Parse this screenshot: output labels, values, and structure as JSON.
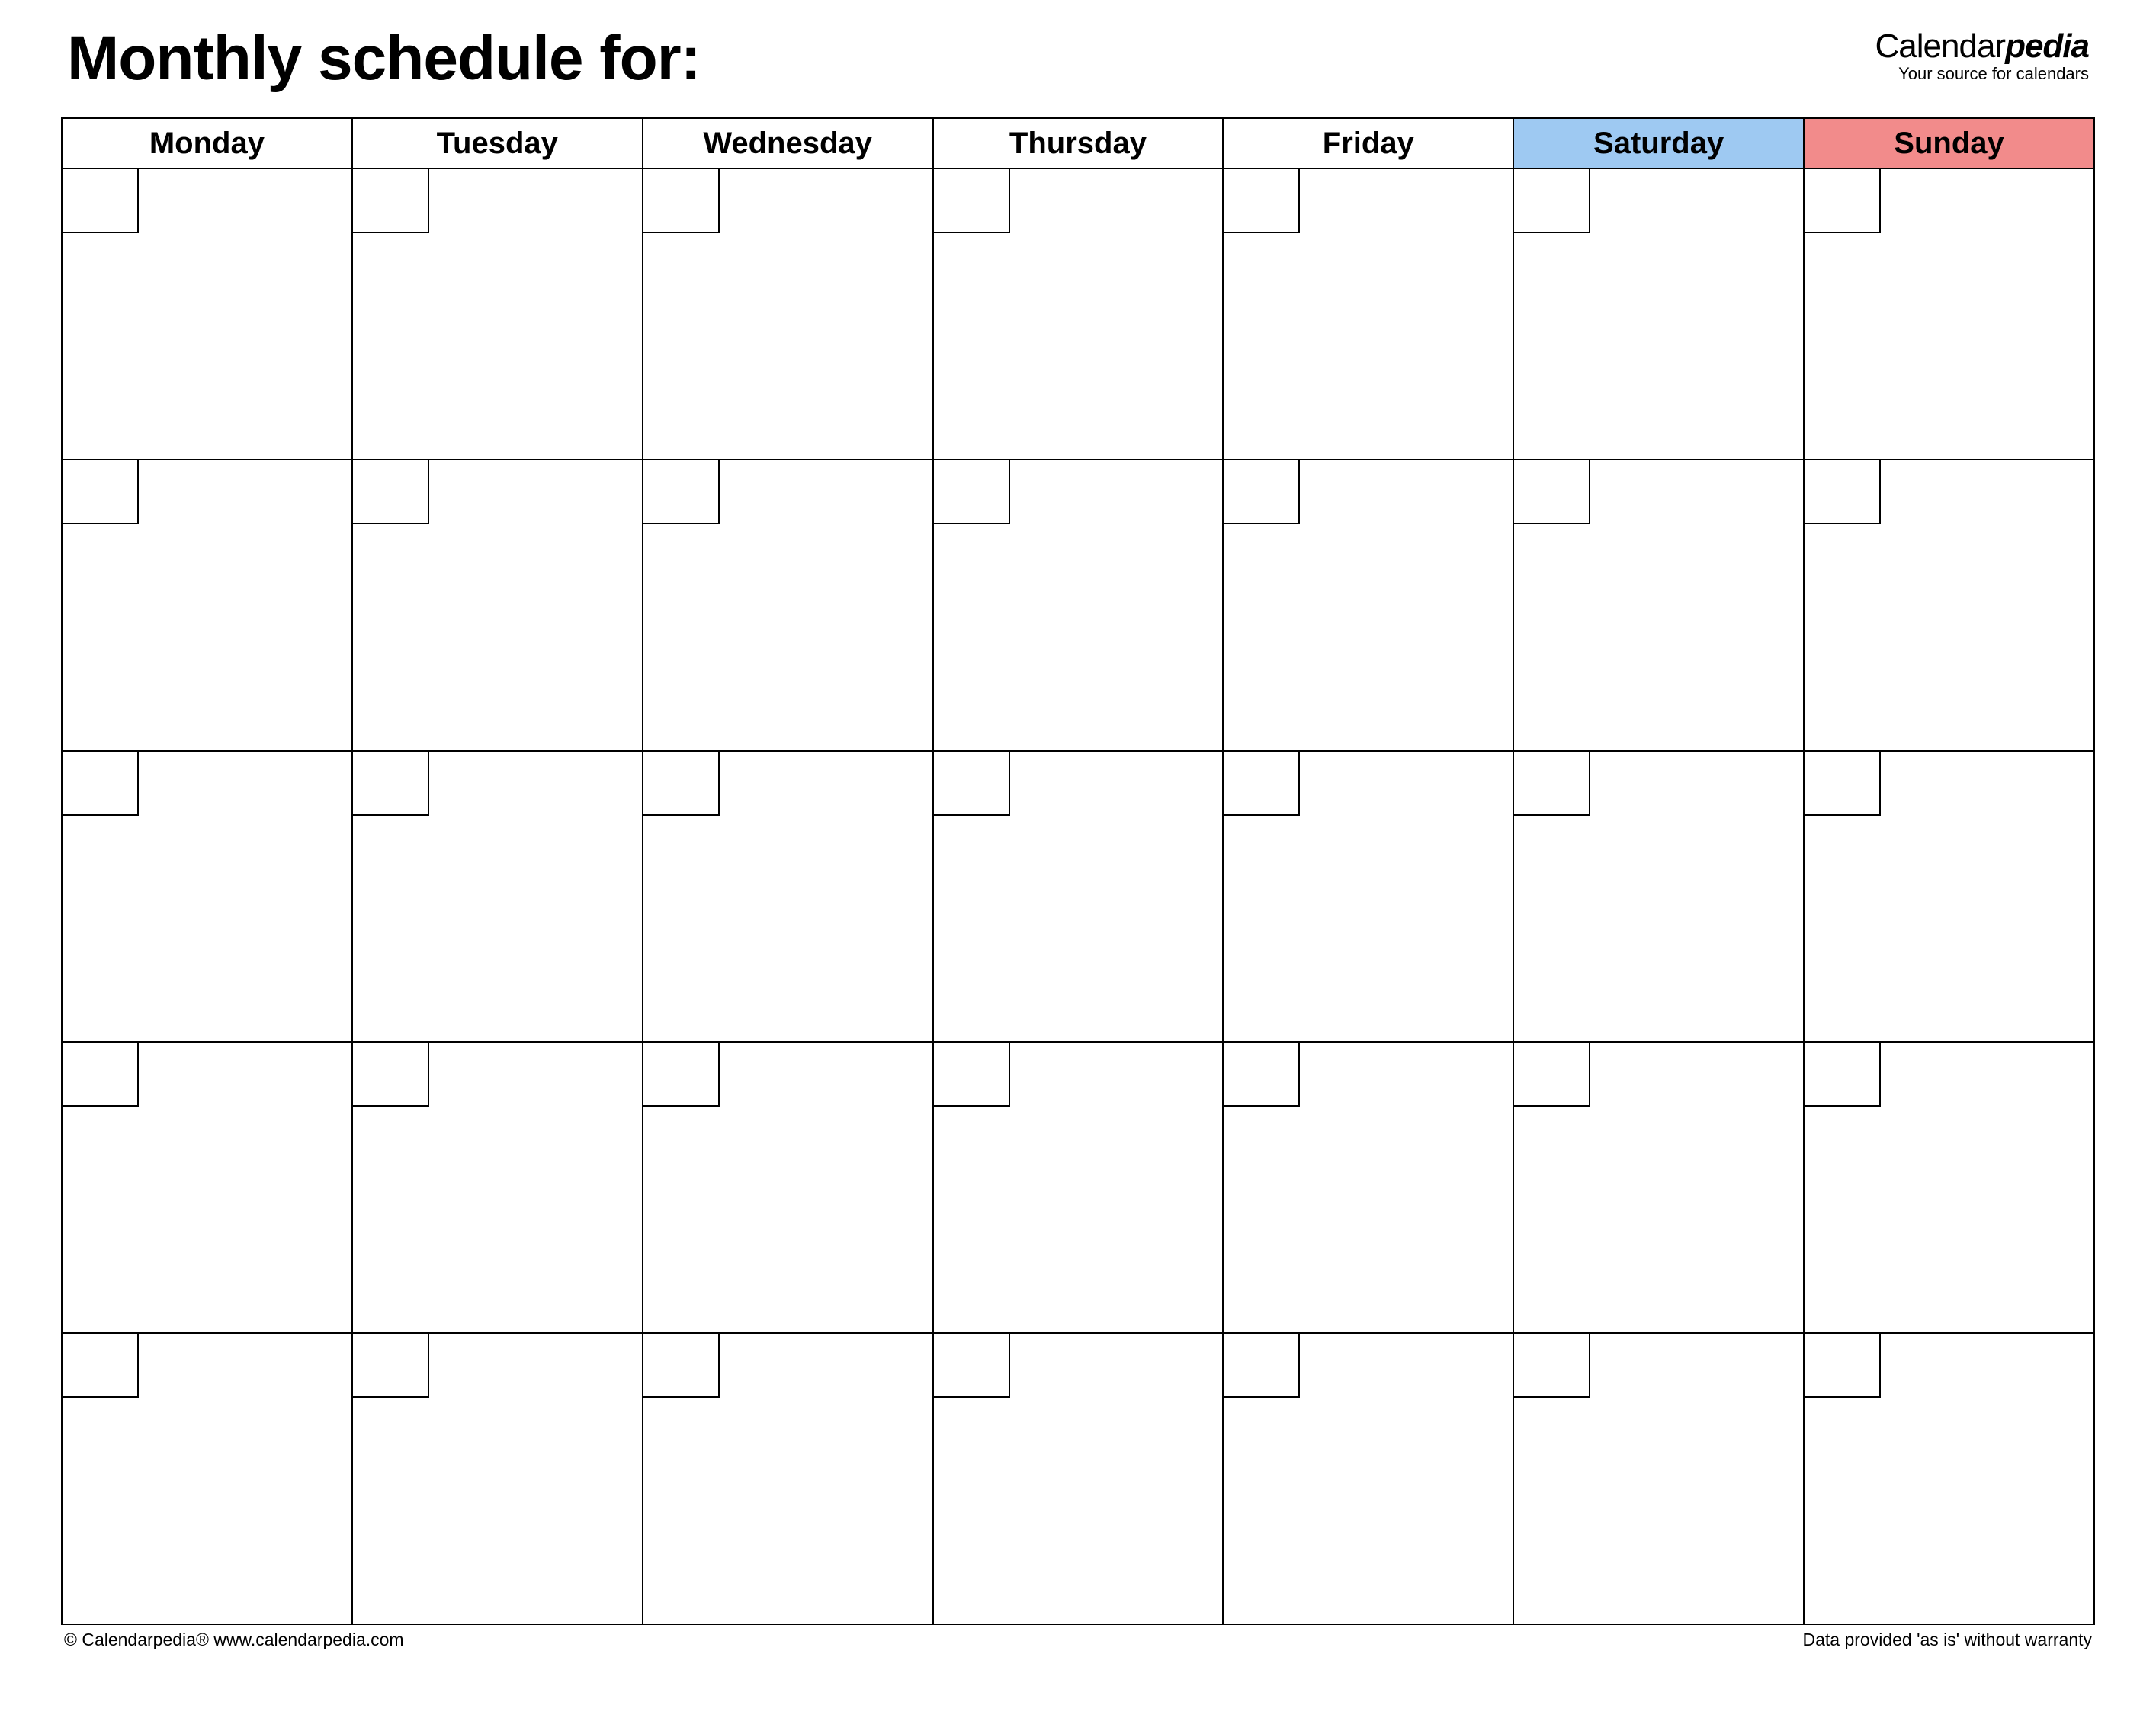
{
  "header": {
    "title": "Monthly schedule for:",
    "brand_left": "Calendar",
    "brand_right": "pedia",
    "brand_tagline": "Your source for calendars"
  },
  "days": {
    "mon": "Monday",
    "tue": "Tuesday",
    "wed": "Wednesday",
    "thu": "Thursday",
    "fri": "Friday",
    "sat": "Saturday",
    "sun": "Sunday"
  },
  "grid": {
    "weeks": 5,
    "columns": 7,
    "dates": [
      [
        "",
        "",
        "",
        "",
        "",
        "",
        ""
      ],
      [
        "",
        "",
        "",
        "",
        "",
        "",
        ""
      ],
      [
        "",
        "",
        "",
        "",
        "",
        "",
        ""
      ],
      [
        "",
        "",
        "",
        "",
        "",
        "",
        ""
      ],
      [
        "",
        "",
        "",
        "",
        "",
        "",
        ""
      ]
    ]
  },
  "footer": {
    "copyright": "© Calendarpedia®   www.calendarpedia.com",
    "disclaimer": "Data provided 'as is' without warranty"
  },
  "colors": {
    "saturday_bg": "#9ec9f2",
    "sunday_bg": "#f28b8b"
  }
}
